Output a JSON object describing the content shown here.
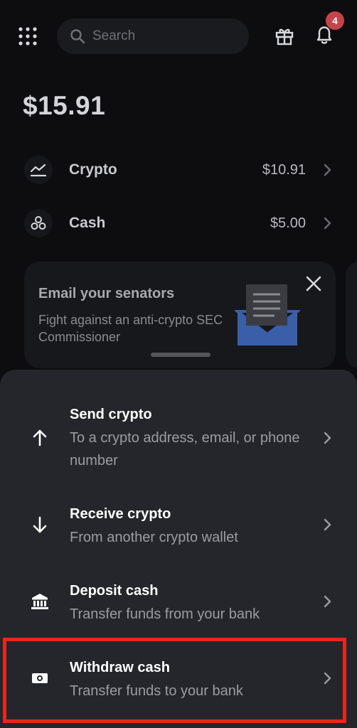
{
  "header": {
    "search_placeholder": "Search",
    "notification_count": "4",
    "icons": [
      "apps-grid-icon",
      "search-icon",
      "gift-icon",
      "bell-icon"
    ]
  },
  "balance": {
    "total": "$15.91",
    "rows": [
      {
        "label": "Crypto",
        "value": "$10.91",
        "icon": "chart-icon"
      },
      {
        "label": "Cash",
        "value": "$5.00",
        "icon": "coins-icon"
      }
    ]
  },
  "promo": {
    "title": "Email your senators",
    "text": "Fight against an anti-crypto SEC Commissioner",
    "icon": "envelope-letter-icon"
  },
  "actions": [
    {
      "title": "Send crypto",
      "subtitle": "To a crypto address, email, or phone number",
      "icon": "arrow-up-icon"
    },
    {
      "title": "Receive crypto",
      "subtitle": "From another crypto wallet",
      "icon": "arrow-down-icon"
    },
    {
      "title": "Deposit cash",
      "subtitle": "Transfer funds from your bank",
      "icon": "bank-icon"
    },
    {
      "title": "Withdraw cash",
      "subtitle": "Transfer funds to your bank",
      "icon": "cash-bill-icon"
    }
  ],
  "colors": {
    "background": "#0d0d0f",
    "sheet": "#25262b",
    "badge": "#c4444a",
    "highlight": "#e8261c",
    "promo_blue": "#3a5fa8"
  }
}
